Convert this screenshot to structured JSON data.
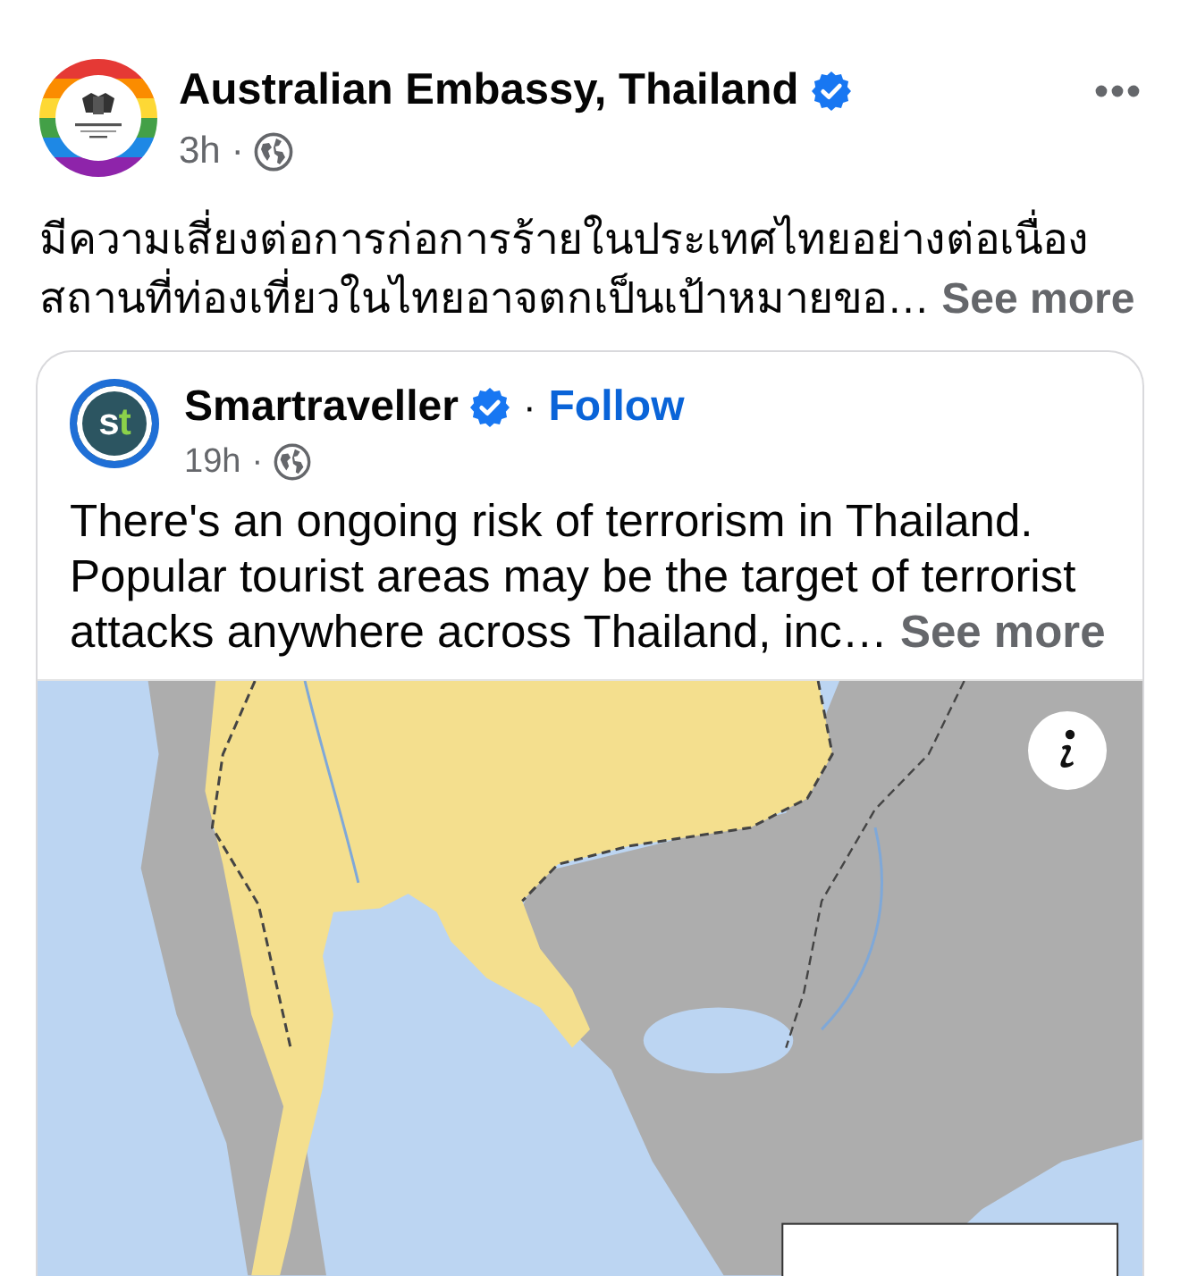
{
  "post": {
    "author": "Australian Embassy, Thailand",
    "verified": true,
    "time": "3h",
    "separator": "·",
    "public": true,
    "text": "มีความเสี่ยงต่อการก่อการร้ายในประเทศไทยอย่างต่อเนื่อง\nสถานที่ท่องเที่ยวในไทยอาจตกเป็นเป้าหมายขอ…",
    "see_more": "See more"
  },
  "shared_post": {
    "logo": "st",
    "author": "Smartraveller",
    "verified": true,
    "follow_separator": "·",
    "follow": "Follow",
    "time": "19h",
    "separator": "·",
    "public": true,
    "text": "There's an ongoing risk of terrorism in Thailand.\nPopular tourist areas may be the target of terrorist\nattacks anywhere across Thailand, inc…",
    "see_more": "See more"
  }
}
